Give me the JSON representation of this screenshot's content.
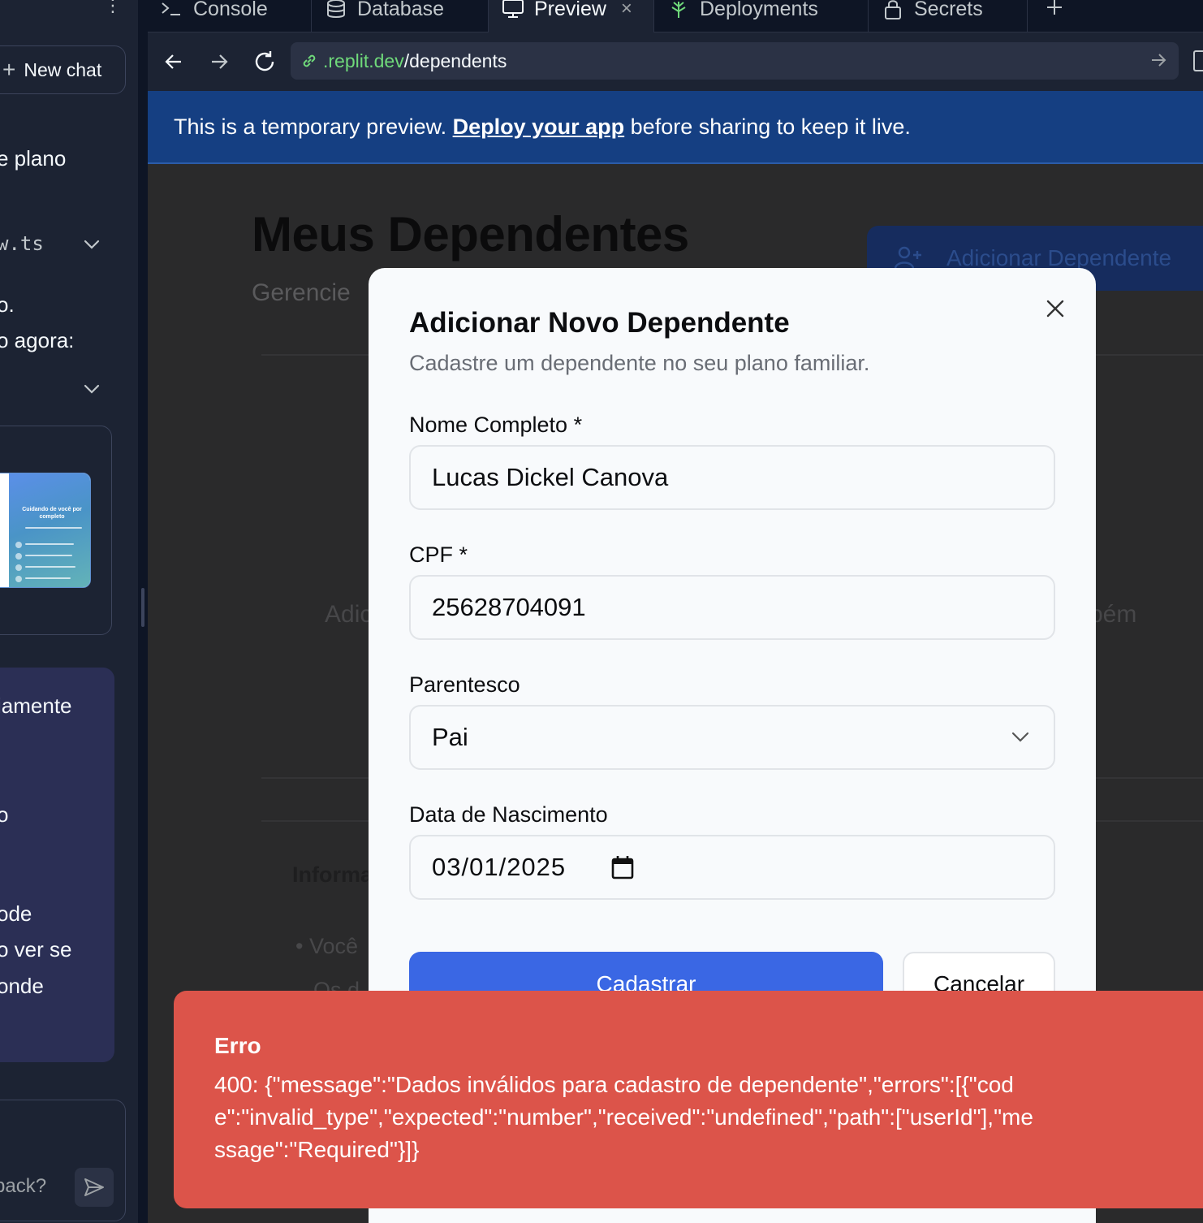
{
  "sidebar": {
    "new_chat_label": "New chat",
    "fragment_1": "e plano",
    "file_fragment": "w.ts",
    "fragment_2": "o.",
    "fragment_3": "o agora:",
    "thumbnail_title": "Cuidando de você por completo",
    "msg_line_1": "iamente",
    "msg_line_2": "o",
    "msg_line_3": "ode",
    "msg_line_4": "o ver se",
    "msg_line_5": "onde",
    "input_placeholder": "back?"
  },
  "tabs": [
    {
      "label": "Console",
      "icon": "console-icon"
    },
    {
      "label": "Database",
      "icon": "database-icon"
    },
    {
      "label": "Preview",
      "icon": "monitor-icon",
      "active": true
    },
    {
      "label": "Deployments",
      "icon": "deploy-icon"
    },
    {
      "label": "Secrets",
      "icon": "lock-icon"
    }
  ],
  "tab_close": "×",
  "address_bar": {
    "host": ".replit.dev",
    "path": "/dependents"
  },
  "banner": {
    "text_before": "This is a temporary preview. ",
    "link": "Deploy your app",
    "text_after": " before sharing to keep it live."
  },
  "page": {
    "title": "Meus Dependentes",
    "subtitle_fragment": "Gerencie",
    "add_button_label": "Adicionar Dependente",
    "empty_text_left": "Adic",
    "empty_text_right": "bém",
    "info_fragment": "Informa",
    "bullet_1": "• Você",
    "bullet_2": "Os d"
  },
  "modal": {
    "title": "Adicionar Novo Dependente",
    "description": "Cadastre um dependente no seu plano familiar.",
    "fields": {
      "name_label": "Nome Completo *",
      "name_value": "Lucas Dickel Canova",
      "cpf_label": "CPF *",
      "cpf_value": "25628704091",
      "relation_label": "Parentesco",
      "relation_value": "Pai",
      "birth_label": "Data de Nascimento",
      "birth_value": "03/01/2025"
    },
    "submit_label": "Cadastrar",
    "cancel_label": "Cancelar"
  },
  "toast": {
    "title": "Erro",
    "message": "400: {\"message\":\"Dados inválidos para cadastro de dependente\",\"errors\":[{\"code\":\"invalid_type\",\"expected\":\"number\",\"received\":\"undefined\",\"path\":[\"userId\"],\"message\":\"Required\"}]}"
  },
  "colors": {
    "ide_bg": "#0e1525",
    "panel_bg": "#1c2333",
    "banner_bg": "#153f82",
    "primary_button": "#3a67e4",
    "toast_bg": "#dc544a",
    "url_host": "#6fd97a"
  }
}
